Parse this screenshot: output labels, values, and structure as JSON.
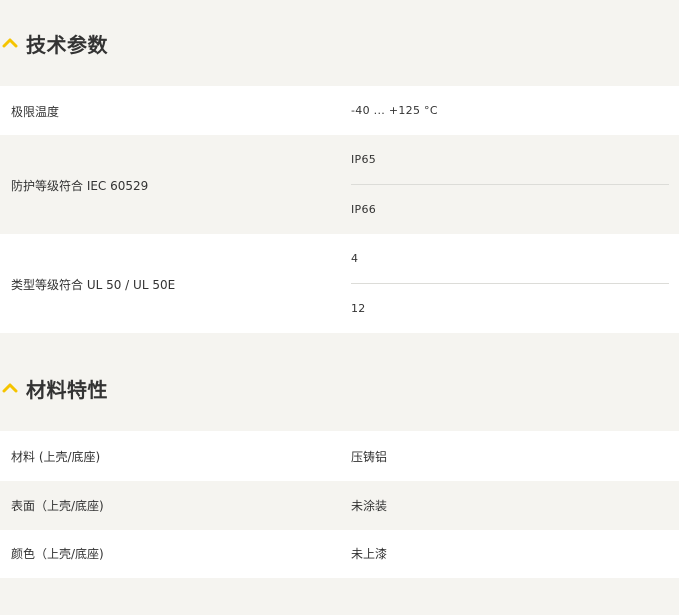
{
  "technical_parameters": {
    "title": "技术参数",
    "rows": [
      {
        "label": "极限温度",
        "values": [
          "-40 ... +125 °C"
        ]
      },
      {
        "label": "防护等级符合 IEC 60529",
        "values": [
          "IP65",
          "IP66"
        ]
      },
      {
        "label": "类型等级符合 UL 50 / UL 50E",
        "values": [
          "4",
          "12"
        ]
      }
    ]
  },
  "material_properties": {
    "title": "材料特性",
    "rows": [
      {
        "label": "材料 (上壳/底座)",
        "values": [
          "压铸铝"
        ]
      },
      {
        "label": "表面（上壳/底座)",
        "values": [
          "未涂装"
        ]
      },
      {
        "label": "颜色（上壳/底座)",
        "values": [
          "未上漆"
        ]
      }
    ]
  },
  "colors": {
    "accent": "#f5c400",
    "background": "#f5f4f0",
    "row_white": "#ffffff",
    "text": "#333333"
  },
  "icons": {
    "section_toggle": "chevron-up-icon"
  }
}
